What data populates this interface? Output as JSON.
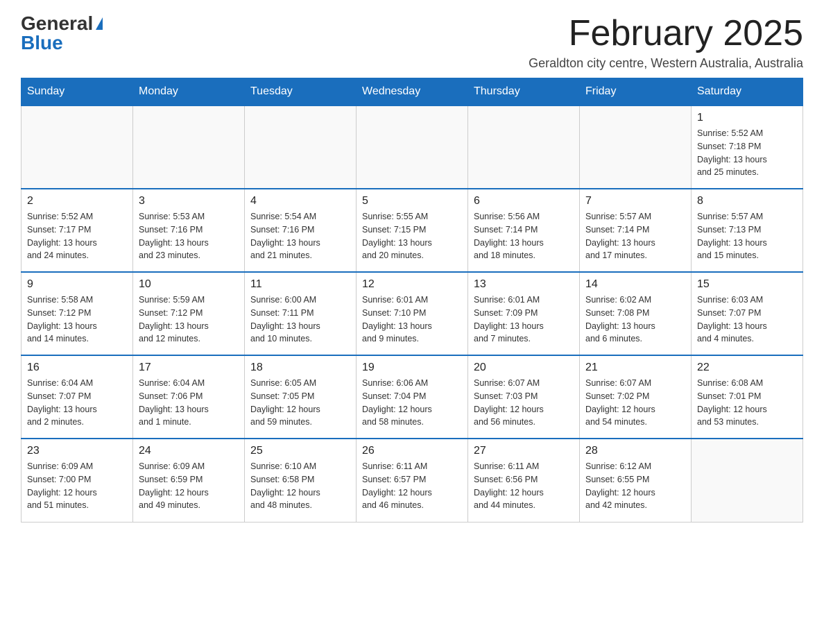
{
  "header": {
    "logo_general": "General",
    "logo_blue": "Blue",
    "month_title": "February 2025",
    "subtitle": "Geraldton city centre, Western Australia, Australia"
  },
  "days_of_week": [
    "Sunday",
    "Monday",
    "Tuesday",
    "Wednesday",
    "Thursday",
    "Friday",
    "Saturday"
  ],
  "weeks": [
    [
      {
        "day": "",
        "info": ""
      },
      {
        "day": "",
        "info": ""
      },
      {
        "day": "",
        "info": ""
      },
      {
        "day": "",
        "info": ""
      },
      {
        "day": "",
        "info": ""
      },
      {
        "day": "",
        "info": ""
      },
      {
        "day": "1",
        "info": "Sunrise: 5:52 AM\nSunset: 7:18 PM\nDaylight: 13 hours\nand 25 minutes."
      }
    ],
    [
      {
        "day": "2",
        "info": "Sunrise: 5:52 AM\nSunset: 7:17 PM\nDaylight: 13 hours\nand 24 minutes."
      },
      {
        "day": "3",
        "info": "Sunrise: 5:53 AM\nSunset: 7:16 PM\nDaylight: 13 hours\nand 23 minutes."
      },
      {
        "day": "4",
        "info": "Sunrise: 5:54 AM\nSunset: 7:16 PM\nDaylight: 13 hours\nand 21 minutes."
      },
      {
        "day": "5",
        "info": "Sunrise: 5:55 AM\nSunset: 7:15 PM\nDaylight: 13 hours\nand 20 minutes."
      },
      {
        "day": "6",
        "info": "Sunrise: 5:56 AM\nSunset: 7:14 PM\nDaylight: 13 hours\nand 18 minutes."
      },
      {
        "day": "7",
        "info": "Sunrise: 5:57 AM\nSunset: 7:14 PM\nDaylight: 13 hours\nand 17 minutes."
      },
      {
        "day": "8",
        "info": "Sunrise: 5:57 AM\nSunset: 7:13 PM\nDaylight: 13 hours\nand 15 minutes."
      }
    ],
    [
      {
        "day": "9",
        "info": "Sunrise: 5:58 AM\nSunset: 7:12 PM\nDaylight: 13 hours\nand 14 minutes."
      },
      {
        "day": "10",
        "info": "Sunrise: 5:59 AM\nSunset: 7:12 PM\nDaylight: 13 hours\nand 12 minutes."
      },
      {
        "day": "11",
        "info": "Sunrise: 6:00 AM\nSunset: 7:11 PM\nDaylight: 13 hours\nand 10 minutes."
      },
      {
        "day": "12",
        "info": "Sunrise: 6:01 AM\nSunset: 7:10 PM\nDaylight: 13 hours\nand 9 minutes."
      },
      {
        "day": "13",
        "info": "Sunrise: 6:01 AM\nSunset: 7:09 PM\nDaylight: 13 hours\nand 7 minutes."
      },
      {
        "day": "14",
        "info": "Sunrise: 6:02 AM\nSunset: 7:08 PM\nDaylight: 13 hours\nand 6 minutes."
      },
      {
        "day": "15",
        "info": "Sunrise: 6:03 AM\nSunset: 7:07 PM\nDaylight: 13 hours\nand 4 minutes."
      }
    ],
    [
      {
        "day": "16",
        "info": "Sunrise: 6:04 AM\nSunset: 7:07 PM\nDaylight: 13 hours\nand 2 minutes."
      },
      {
        "day": "17",
        "info": "Sunrise: 6:04 AM\nSunset: 7:06 PM\nDaylight: 13 hours\nand 1 minute."
      },
      {
        "day": "18",
        "info": "Sunrise: 6:05 AM\nSunset: 7:05 PM\nDaylight: 12 hours\nand 59 minutes."
      },
      {
        "day": "19",
        "info": "Sunrise: 6:06 AM\nSunset: 7:04 PM\nDaylight: 12 hours\nand 58 minutes."
      },
      {
        "day": "20",
        "info": "Sunrise: 6:07 AM\nSunset: 7:03 PM\nDaylight: 12 hours\nand 56 minutes."
      },
      {
        "day": "21",
        "info": "Sunrise: 6:07 AM\nSunset: 7:02 PM\nDaylight: 12 hours\nand 54 minutes."
      },
      {
        "day": "22",
        "info": "Sunrise: 6:08 AM\nSunset: 7:01 PM\nDaylight: 12 hours\nand 53 minutes."
      }
    ],
    [
      {
        "day": "23",
        "info": "Sunrise: 6:09 AM\nSunset: 7:00 PM\nDaylight: 12 hours\nand 51 minutes."
      },
      {
        "day": "24",
        "info": "Sunrise: 6:09 AM\nSunset: 6:59 PM\nDaylight: 12 hours\nand 49 minutes."
      },
      {
        "day": "25",
        "info": "Sunrise: 6:10 AM\nSunset: 6:58 PM\nDaylight: 12 hours\nand 48 minutes."
      },
      {
        "day": "26",
        "info": "Sunrise: 6:11 AM\nSunset: 6:57 PM\nDaylight: 12 hours\nand 46 minutes."
      },
      {
        "day": "27",
        "info": "Sunrise: 6:11 AM\nSunset: 6:56 PM\nDaylight: 12 hours\nand 44 minutes."
      },
      {
        "day": "28",
        "info": "Sunrise: 6:12 AM\nSunset: 6:55 PM\nDaylight: 12 hours\nand 42 minutes."
      },
      {
        "day": "",
        "info": ""
      }
    ]
  ]
}
